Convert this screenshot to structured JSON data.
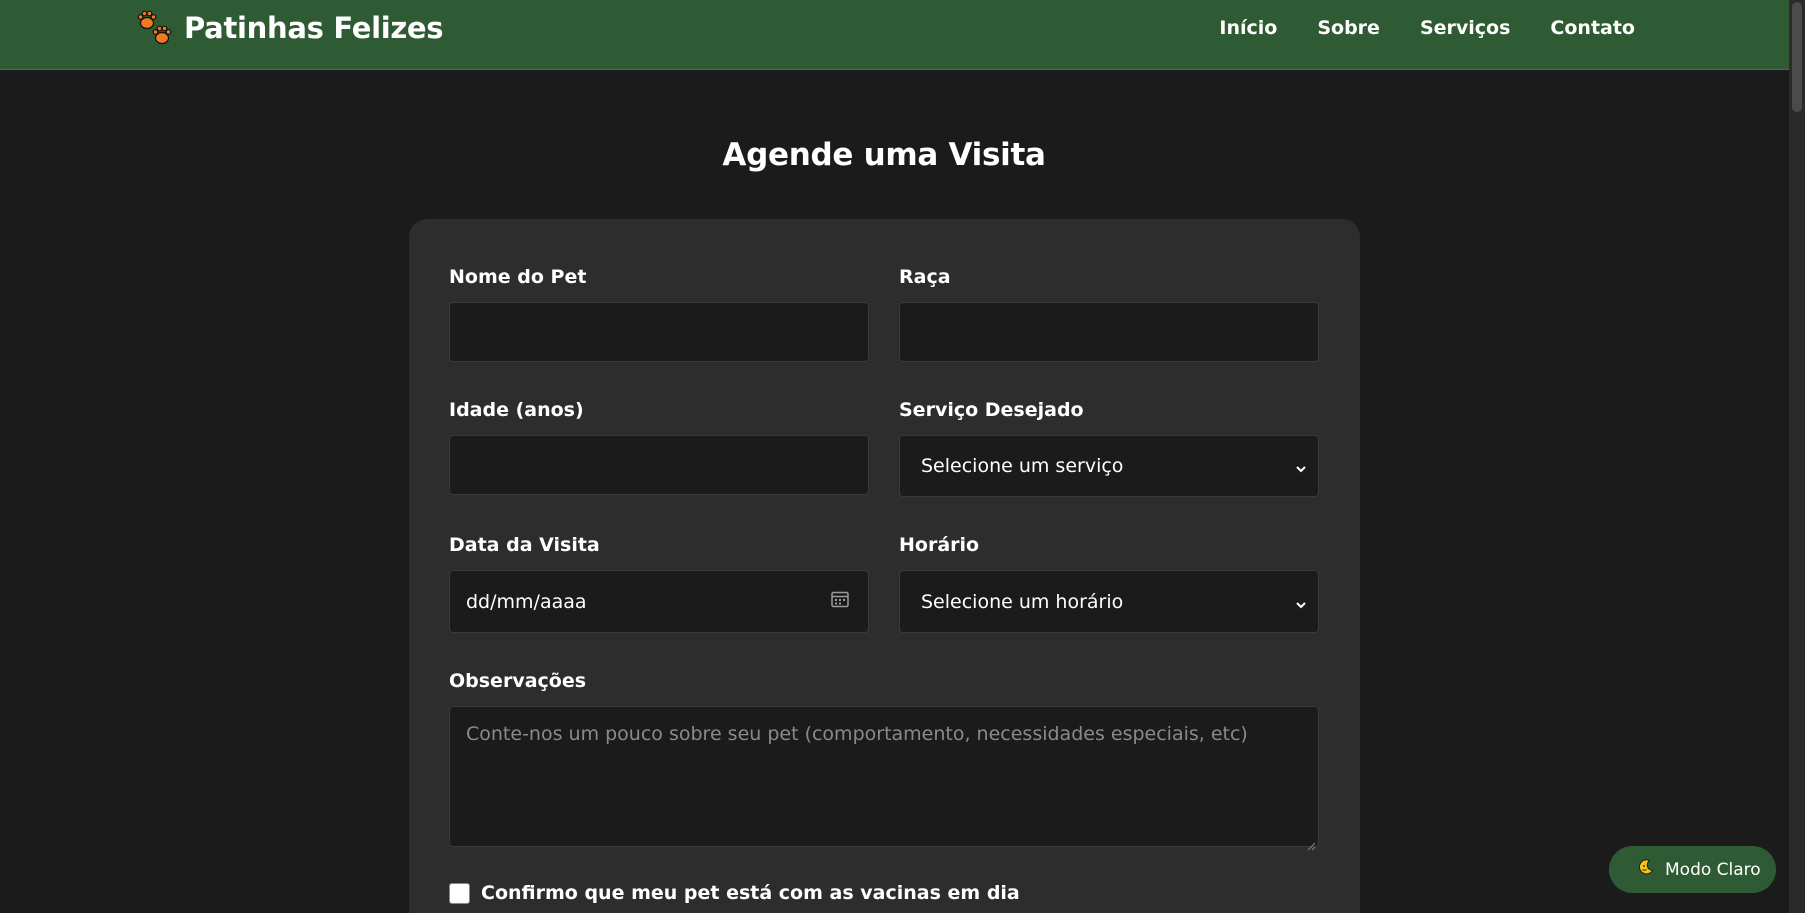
{
  "header": {
    "brand_name": "Patinhas Felizes",
    "nav": [
      "Início",
      "Sobre",
      "Serviços",
      "Contato"
    ]
  },
  "page": {
    "title": "Agende uma Visita"
  },
  "form": {
    "pet_name_label": "Nome do Pet",
    "breed_label": "Raça",
    "age_label": "Idade (anos)",
    "service_label": "Serviço Desejado",
    "service_value": "Selecione um serviço",
    "date_label": "Data da Visita",
    "date_placeholder": "dd/mm/aaaa",
    "time_label": "Horário",
    "time_value": "Selecione um horário",
    "notes_label": "Observações",
    "notes_placeholder": "Conte-nos um pouco sobre seu pet (comportamento, necessidades especiais, etc)",
    "vaccine_label": "Confirmo que meu pet está com as vacinas em dia",
    "vaccine_checked": false
  },
  "theme_toggle": {
    "label": "Modo Claro",
    "icon": "moon-icon"
  },
  "colors": {
    "header_bg": "#2e5b34",
    "page_bg": "#1b1b1b",
    "card_bg": "#2d2d2d",
    "paw_orange": "#f07a1f"
  }
}
